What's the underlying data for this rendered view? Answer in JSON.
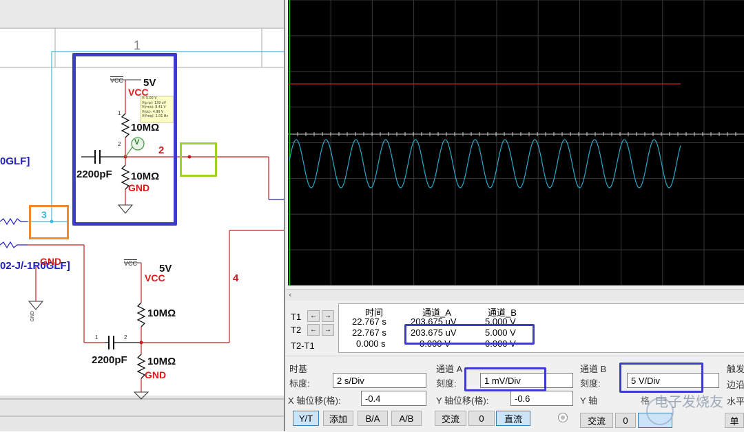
{
  "schematic": {
    "column_number": "1",
    "net_labels": {
      "net2": "2",
      "net3": "3",
      "net4": "4"
    },
    "left_labels": {
      "top": "0GLF]",
      "bottom": "02-J/-1R0GLF]"
    },
    "upper_circuit": {
      "vcc_rail": "VCC",
      "supply": "5V",
      "vcc_name": "VCC",
      "r1": "10MΩ",
      "r2": "10MΩ",
      "cap": "2200pF",
      "gnd": "GND",
      "pin1": "1",
      "pin2": "2",
      "probe_symbol": "V",
      "probe_tooltip": [
        "V: 5.00 V",
        "V(p-p): 139 uV",
        "V(rms): 8.41 V",
        "V(dc): 4.99 V",
        "V(freq): 1.01 Hz"
      ]
    },
    "lower_circuit": {
      "vcc_rail": "VCC",
      "supply": "5V",
      "vcc_name": "VCC",
      "r1": "10MΩ",
      "r2": "10MΩ",
      "cap": "2200pF",
      "gnd": "GND",
      "pin1": "1",
      "pin2": "2"
    },
    "left_gnd": "GND",
    "gnd_symbol_text": "GND"
  },
  "scope": {
    "trace_a_color": "#2aa8c8",
    "trace_b_color": "#c81e1e",
    "grid_color": "#3a3a3a",
    "cursor_color": "#00c000",
    "readout": {
      "headers": {
        "time": "时间",
        "channel_a": "通道_A",
        "channel_b": "通道_B"
      },
      "rows": [
        {
          "label": "T1",
          "time": "22.767 s",
          "a": "203.675 uV",
          "b": "5.000 V"
        },
        {
          "label": "T2",
          "time": "22.767 s",
          "a": "203.675 uV",
          "b": "5.000 V"
        },
        {
          "label": "T2-T1",
          "time": "0.000 s",
          "a": "0.000 V",
          "b": "0.000 V"
        }
      ],
      "arrow_left": "←",
      "arrow_right": "→"
    },
    "timebase": {
      "title": "时基",
      "scale_label": "标度:",
      "scale_value": "2  s/Div",
      "xpos_label": "X 轴位移(格):",
      "xpos_value": "-0.4",
      "buttons": [
        "Y/T",
        "添加",
        "B/A",
        "A/B"
      ]
    },
    "channel_a": {
      "title": "通道 A",
      "scale_label": "刻度:",
      "scale_value": "1  mV/Div",
      "ypos_label": "Y 轴位移(格):",
      "ypos_value": "-0.6",
      "buttons": [
        "交流",
        "0",
        "直流"
      ]
    },
    "channel_b": {
      "title": "通道 B",
      "scale_label": "刻度:",
      "scale_value": "5  V/Div",
      "ypos_label": "Y 轴",
      "ypos_extra": "格",
      "buttons": [
        "交流",
        "0"
      ]
    },
    "trigger": {
      "title": "触发",
      "edge_label": "边沿",
      "level_label": "水平",
      "single": "单"
    },
    "watermark": "电子发烧友"
  }
}
